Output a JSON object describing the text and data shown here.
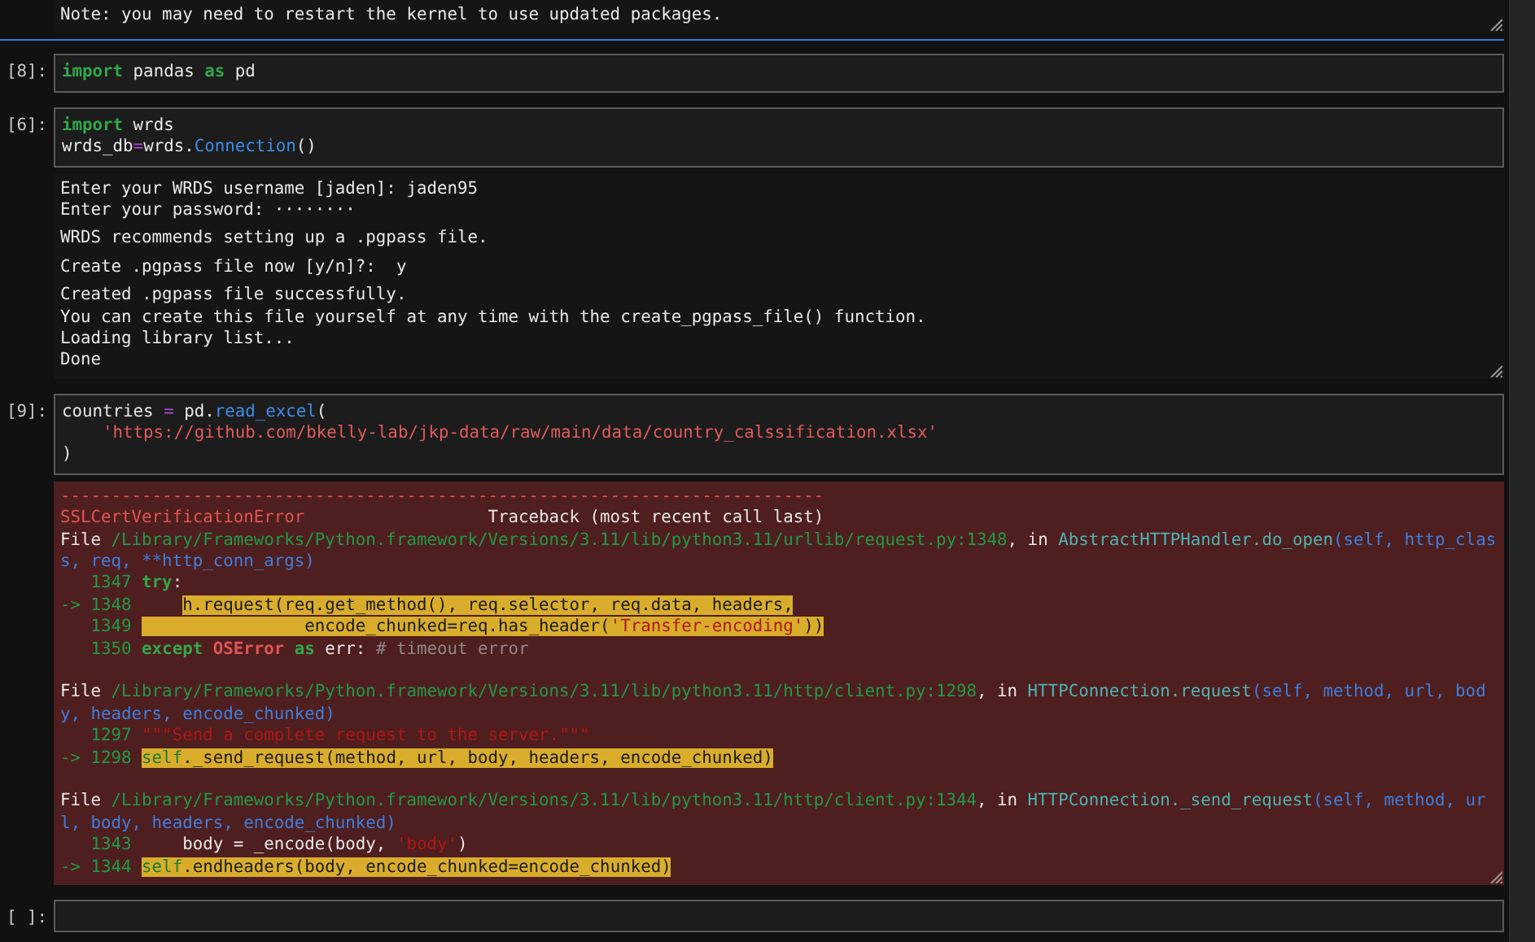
{
  "cells": [
    {
      "selected": true,
      "outputs": [
        {
          "kind": "stream",
          "groups": [
            [
              [
                {
                  "t": "Note: you may need to restart the kernel to use updated packages.",
                  "kind": "text"
                }
              ]
            ]
          ]
        }
      ]
    },
    {
      "prompt": "[8]:",
      "selected": false,
      "input": [
        [
          {
            "t": "import",
            "kind": "keyword"
          },
          {
            "t": " pandas ",
            "kind": "text"
          },
          {
            "t": "as",
            "kind": "keyword"
          },
          {
            "t": " pd",
            "kind": "text"
          }
        ]
      ]
    },
    {
      "prompt": "[6]:",
      "selected": false,
      "input": [
        [
          {
            "t": "import",
            "kind": "keyword"
          },
          {
            "t": " wrds",
            "kind": "text"
          }
        ],
        [
          {
            "t": "wrds_db",
            "kind": "text"
          },
          {
            "t": "=",
            "kind": "op"
          },
          {
            "t": "wrds.",
            "kind": "text"
          },
          {
            "t": "Connection",
            "kind": "func"
          },
          {
            "t": "()",
            "kind": "text"
          }
        ]
      ],
      "outputs": [
        {
          "kind": "stream",
          "groups": [
            [
              [
                {
                  "t": "Enter your WRDS username [jaden]: jaden95",
                  "kind": "text"
                }
              ],
              [
                {
                  "t": "Enter your password: ········",
                  "kind": "text"
                }
              ]
            ],
            [
              [
                {
                  "t": "WRDS recommends setting up a .pgpass file.",
                  "kind": "text"
                }
              ]
            ],
            [
              [
                {
                  "t": "Create .pgpass file now [y/n]?:  y",
                  "kind": "text"
                }
              ]
            ],
            [
              [
                {
                  "t": "Created .pgpass file successfully.",
                  "kind": "text"
                }
              ],
              [
                {
                  "t": "You can create this file yourself at any time with the create_pgpass_file() function.",
                  "kind": "text"
                }
              ],
              [
                {
                  "t": "Loading library list...",
                  "kind": "text"
                }
              ],
              [
                {
                  "t": "Done",
                  "kind": "text"
                }
              ]
            ]
          ]
        }
      ]
    },
    {
      "prompt": "[9]:",
      "selected": false,
      "input": [
        [
          {
            "t": "countries ",
            "kind": "text"
          },
          {
            "t": "=",
            "kind": "op"
          },
          {
            "t": " pd.",
            "kind": "text"
          },
          {
            "t": "read_excel",
            "kind": "func"
          },
          {
            "t": "(",
            "kind": "text"
          }
        ],
        [
          {
            "t": "    'https://github.com/bkelly-lab/jkp-data/raw/main/data/country_calssification.xlsx'",
            "kind": "string"
          }
        ],
        [
          {
            "t": ")",
            "kind": "text"
          }
        ]
      ],
      "outputs": [
        {
          "kind": "error",
          "groups": [
            [
              [
                {
                  "t": "---------------------------------------------------------------------------",
                  "kind": "exc"
                }
              ],
              [
                {
                  "t": "SSLCertVerificationError",
                  "kind": "exc"
                },
                {
                  "t": "                  Traceback (most recent call last)",
                  "kind": "text"
                }
              ],
              [
                {
                  "t": "File ",
                  "kind": "text"
                },
                {
                  "t": "/Library/Frameworks/Python.framework/Versions/3.11/lib/python3.11/urllib/request.py:1348",
                  "kind": "path"
                },
                {
                  "t": ", in ",
                  "kind": "text"
                },
                {
                  "t": "AbstractHTTPHandler.do_open",
                  "kind": "method"
                },
                {
                  "t": "(self, http_clas",
                  "kind": "param"
                }
              ],
              [
                {
                  "t": "s, req, **http_conn_args)",
                  "kind": "param"
                }
              ],
              [
                {
                  "t": "   1347 ",
                  "kind": "lineno"
                },
                {
                  "t": "try",
                  "kind": "keyword"
                },
                {
                  "t": ":",
                  "kind": "text"
                }
              ],
              [
                {
                  "t": "-> 1348     ",
                  "kind": "lineno"
                },
                {
                  "t": "h.request(req.get_method(), req.selector, req.data, headers,",
                  "kind": "hl-text"
                }
              ],
              [
                {
                  "t": "   1349 ",
                  "kind": "lineno"
                },
                {
                  "t": "                encode_chunked=req.has_header(",
                  "kind": "hl-text"
                },
                {
                  "t": "'Transfer-encoding'",
                  "kind": "hl-string"
                },
                {
                  "t": "))",
                  "kind": "hl-text"
                }
              ],
              [
                {
                  "t": "   1350 ",
                  "kind": "lineno"
                },
                {
                  "t": "except ",
                  "kind": "keyword"
                },
                {
                  "t": "OSError ",
                  "kind": "exc-bold"
                },
                {
                  "t": "as",
                  "kind": "keyword"
                },
                {
                  "t": " err: ",
                  "kind": "text"
                },
                {
                  "t": "# timeout error",
                  "kind": "comment"
                }
              ]
            ],
            [
              [
                {
                  "t": "File ",
                  "kind": "text"
                },
                {
                  "t": "/Library/Frameworks/Python.framework/Versions/3.11/lib/python3.11/http/client.py:1298",
                  "kind": "path"
                },
                {
                  "t": ", in ",
                  "kind": "text"
                },
                {
                  "t": "HTTPConnection.request",
                  "kind": "method"
                },
                {
                  "t": "(self, method, url, bod",
                  "kind": "param"
                }
              ],
              [
                {
                  "t": "y, headers, encode_chunked)",
                  "kind": "param"
                }
              ],
              [
                {
                  "t": "   1297 ",
                  "kind": "lineno"
                },
                {
                  "t": "\"\"\"Send a complete request to the server.\"\"\"",
                  "kind": "docstring"
                }
              ],
              [
                {
                  "t": "-> 1298 ",
                  "kind": "lineno"
                },
                {
                  "t": "self",
                  "kind": "hl-keyword"
                },
                {
                  "t": "._send_request(method, url, body, headers, encode_chunked)",
                  "kind": "hl-text"
                }
              ]
            ],
            [
              [
                {
                  "t": "File ",
                  "kind": "text"
                },
                {
                  "t": "/Library/Frameworks/Python.framework/Versions/3.11/lib/python3.11/http/client.py:1344",
                  "kind": "path"
                },
                {
                  "t": ", in ",
                  "kind": "text"
                },
                {
                  "t": "HTTPConnection._send_request",
                  "kind": "method"
                },
                {
                  "t": "(self, method, ur",
                  "kind": "param"
                }
              ],
              [
                {
                  "t": "l, body, headers, encode_chunked)",
                  "kind": "param"
                }
              ],
              [
                {
                  "t": "   1343 ",
                  "kind": "lineno"
                },
                {
                  "t": "    body = _encode(body, ",
                  "kind": "text"
                },
                {
                  "t": "'body'",
                  "kind": "docstring"
                },
                {
                  "t": ")",
                  "kind": "text"
                }
              ],
              [
                {
                  "t": "-> 1344 ",
                  "kind": "lineno"
                },
                {
                  "t": "self",
                  "kind": "hl-keyword"
                },
                {
                  "t": ".endheaders(body, encode_chunked=encode_chunked)",
                  "kind": "hl-text"
                }
              ]
            ]
          ]
        }
      ]
    },
    {
      "prompt": "[ ]:",
      "selected": false
    }
  ]
}
